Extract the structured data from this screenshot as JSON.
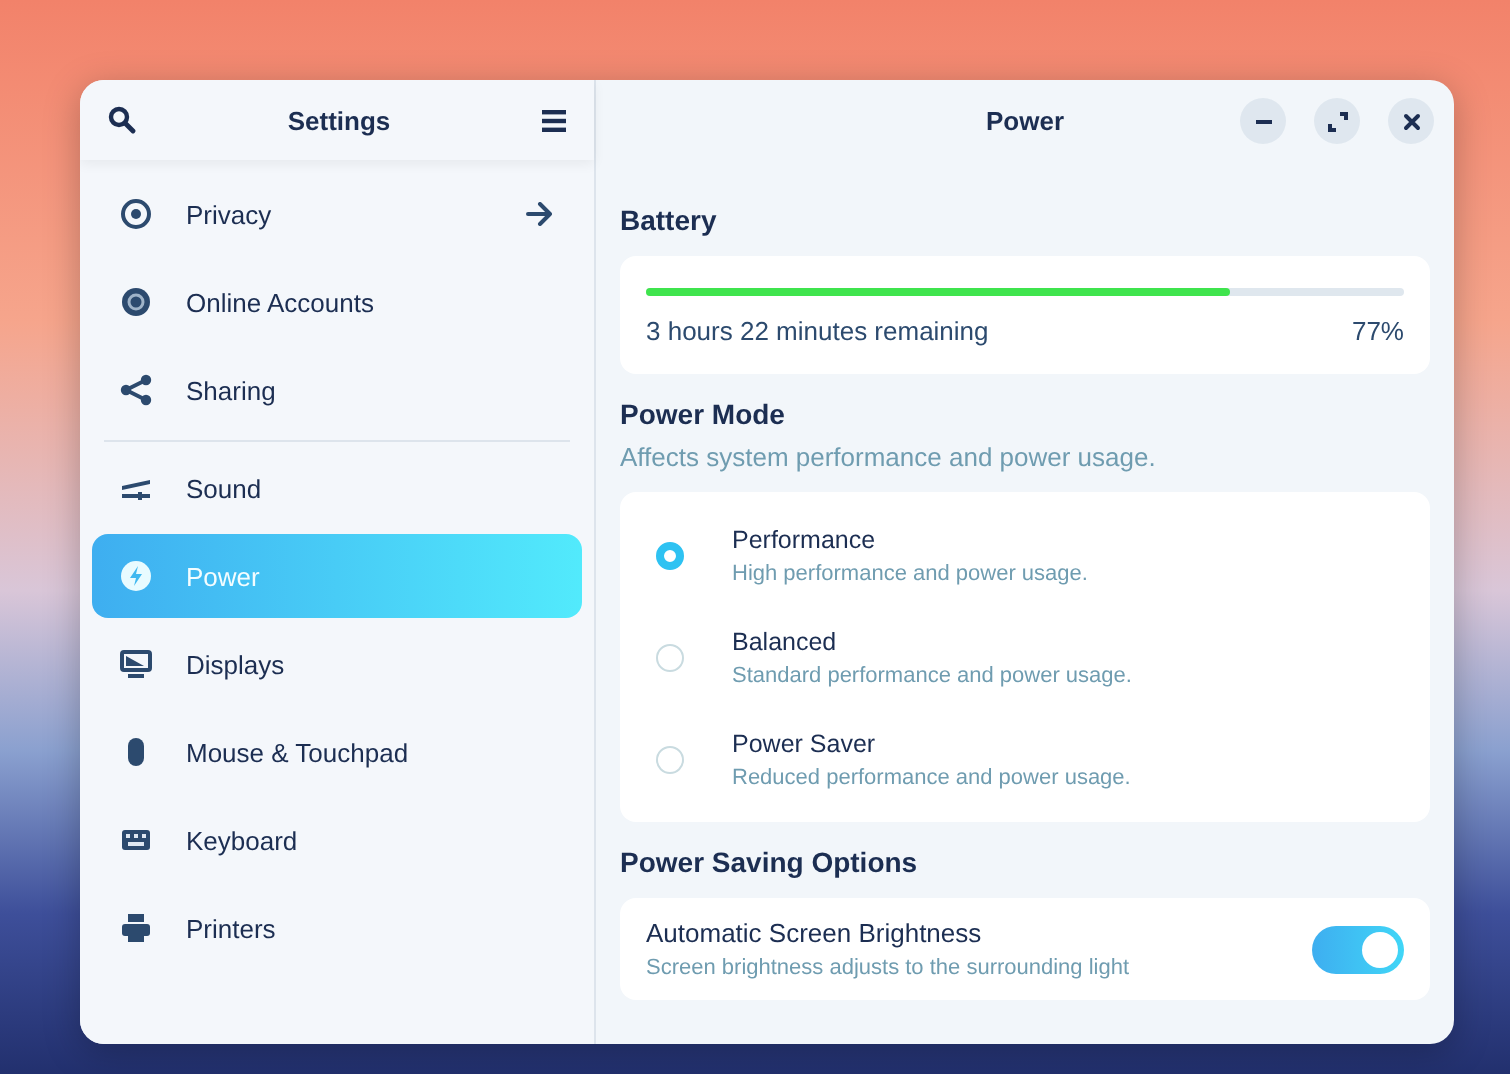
{
  "sidebar": {
    "title": "Settings",
    "items": [
      {
        "label": "Privacy",
        "selected": false
      },
      {
        "label": "Online Accounts",
        "selected": false
      },
      {
        "label": "Sharing",
        "selected": false
      },
      {
        "label": "Sound",
        "selected": false
      },
      {
        "label": "Power",
        "selected": true
      },
      {
        "label": "Displays",
        "selected": false
      },
      {
        "label": "Mouse & Touchpad",
        "selected": false
      },
      {
        "label": "Keyboard",
        "selected": false
      },
      {
        "label": "Printers",
        "selected": false
      }
    ]
  },
  "window": {
    "title": "Power"
  },
  "battery": {
    "heading": "Battery",
    "level": 0.77,
    "remaining": "3 hours 22 minutes remaining",
    "percent": "77%"
  },
  "power_mode": {
    "heading": "Power Mode",
    "description": "Affects system performance and power usage.",
    "options": [
      {
        "label": "Performance",
        "description": "High performance and power usage.",
        "selected": true
      },
      {
        "label": "Balanced",
        "description": "Standard performance and power usage.",
        "selected": false
      },
      {
        "label": "Power Saver",
        "description": "Reduced performance and power usage.",
        "selected": false
      }
    ]
  },
  "power_saving": {
    "heading": "Power Saving Options",
    "options": [
      {
        "label": "Automatic Screen Brightness",
        "description": "Screen brightness adjusts to the surrounding light",
        "on": true
      }
    ]
  }
}
